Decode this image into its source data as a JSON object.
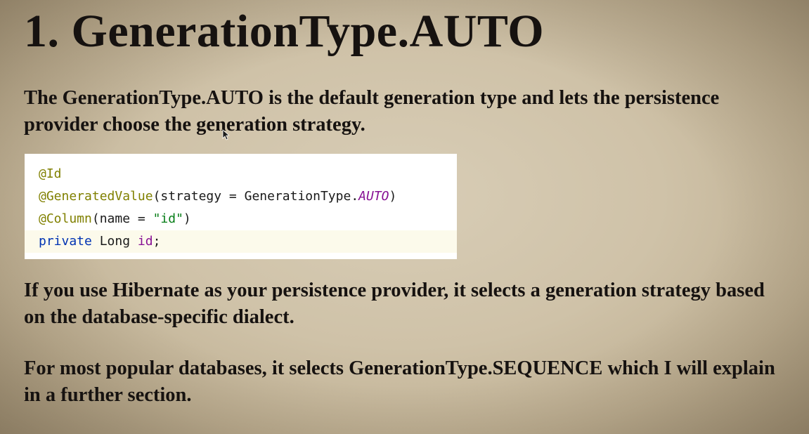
{
  "slide": {
    "title": "1. GenerationType.AUTO",
    "paragraph_1": "The GenerationType.AUTO is the default generation type and lets the persistence provider choose the generation strategy.",
    "paragraph_2": "If you use Hibernate as your persistence provider, it selects a generation strategy based on the database-specific dialect.",
    "paragraph_3": "For most popular databases, it selects GenerationType.SEQUENCE which I will explain in a further section."
  },
  "code": {
    "line1": {
      "annotation": "@Id"
    },
    "line2": {
      "annotation": "@GeneratedValue",
      "open": "(strategy = GenerationType.",
      "constant": "AUTO",
      "close": ")"
    },
    "line3": {
      "annotation": "@Column",
      "open": "(name = ",
      "string": "\"id\"",
      "close": ")"
    },
    "line4": {
      "keyword": "private",
      "type": " Long ",
      "field": "id",
      "end": ";"
    }
  },
  "colors": {
    "background": "#cfc2a8",
    "text": "#161210",
    "annotation": "#808000",
    "keyword": "#0033b3",
    "string": "#067d17",
    "constant": "#871094",
    "current_line": "#fcfaeb"
  },
  "icons": {
    "cursor": "mouse-pointer-icon"
  }
}
